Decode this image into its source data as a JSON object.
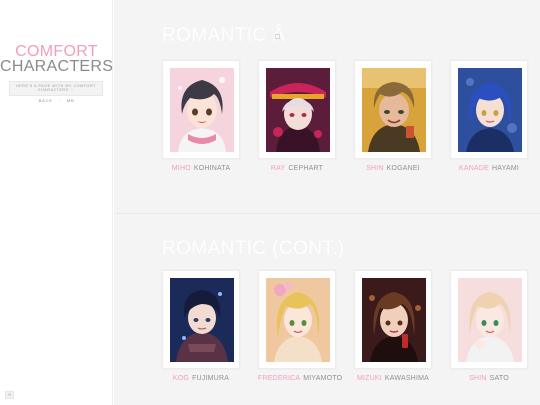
{
  "sidebar": {
    "title_line1": "COMFORT",
    "title_line2": "CHARACTERS",
    "desc_line1": "HERE'S A PAGE WITH MY COMFORT",
    "desc_line2_a": "CHARACTERS",
    "desc_line2_b": "♡",
    "nav_back": "BACK",
    "nav_sep": "·",
    "nav_m": "MB",
    "corner_label": "»"
  },
  "colors": {
    "accent": "#f2a0b4",
    "text": "#909090",
    "background": "#f4f4f4"
  },
  "sections": [
    {
      "title": "ROMANTIC Â",
      "characters": [
        {
          "first": "MIHO",
          "last": "KOHINATA",
          "icon": "portrait-miho-icon"
        },
        {
          "first": "RAY",
          "last": "CEPHART",
          "icon": "portrait-ray-icon"
        },
        {
          "first": "SHIN",
          "last": "KOGANEI",
          "icon": "portrait-shin-koganei-icon"
        },
        {
          "first": "KANADE",
          "last": "HAYAMI",
          "icon": "portrait-kanade-icon"
        }
      ]
    },
    {
      "title": "ROMANTIC (CONT.)",
      "characters": [
        {
          "first": "KOG",
          "last": "FUJIMURA",
          "icon": "portrait-fujimura-icon"
        },
        {
          "first": "FREDERICA",
          "last": "MIYAMOTO",
          "icon": "portrait-frederica-icon"
        },
        {
          "first": "MIZUKI",
          "last": "KAWASHIMA",
          "icon": "portrait-mizuki-icon"
        },
        {
          "first": "SHIN",
          "last": "SATO",
          "icon": "portrait-shin-sato-icon"
        }
      ]
    }
  ]
}
